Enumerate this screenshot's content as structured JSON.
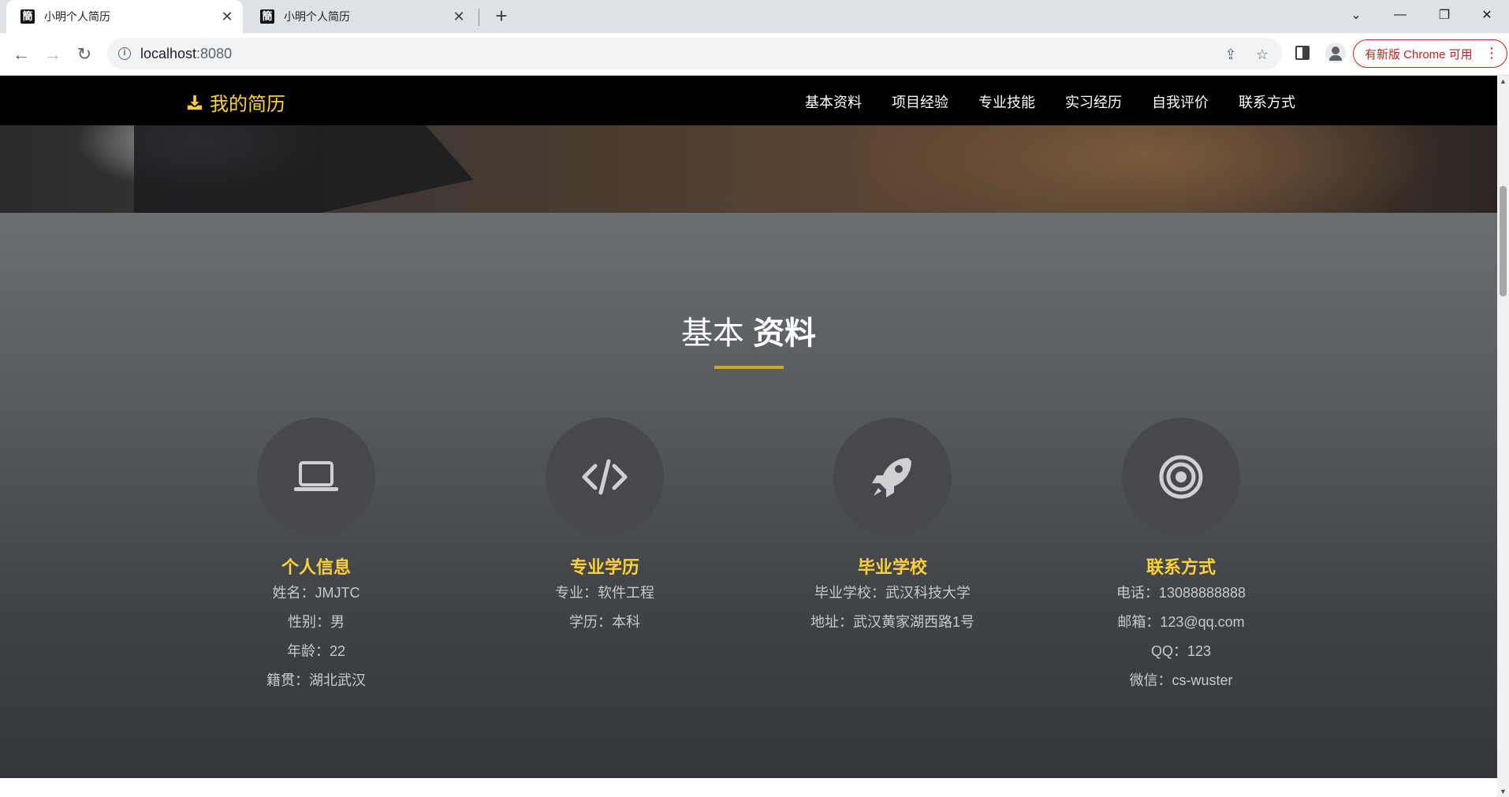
{
  "browser": {
    "tabs": [
      {
        "favicon": "簡",
        "title": "小明个人简历"
      },
      {
        "favicon": "簡",
        "title": "小明个人简历"
      }
    ],
    "url_host": "localhost",
    "url_port": ":8080",
    "update_button": "有新版 Chrome 可用"
  },
  "site": {
    "brand": "我的简历",
    "nav": [
      "基本资料",
      "项目经验",
      "专业技能",
      "实习经历",
      "自我评价",
      "联系方式"
    ]
  },
  "about": {
    "title_light": "基本",
    "title_bold": "资料",
    "cards": [
      {
        "icon": "laptop-icon",
        "title": "个人信息",
        "lines": [
          "姓名：JMJTC",
          "性别：男",
          "年龄：22",
          "籍贯：湖北武汉"
        ]
      },
      {
        "icon": "code-icon",
        "title": "专业学历",
        "lines": [
          "专业：软件工程",
          "学历：本科"
        ]
      },
      {
        "icon": "rocket-icon",
        "title": "毕业学校",
        "lines": [
          "毕业学校：武汉科技大学",
          "地址：武汉黄家湖西路1号"
        ]
      },
      {
        "icon": "target-icon",
        "title": "联系方式",
        "lines": [
          "电话：13088888888",
          "邮箱：123@qq.com",
          "QQ：123",
          "微信：cs-wuster"
        ]
      }
    ]
  },
  "colors": {
    "accent": "#fed136",
    "underline": "#cfa72d",
    "nav_bg": "#000000"
  }
}
